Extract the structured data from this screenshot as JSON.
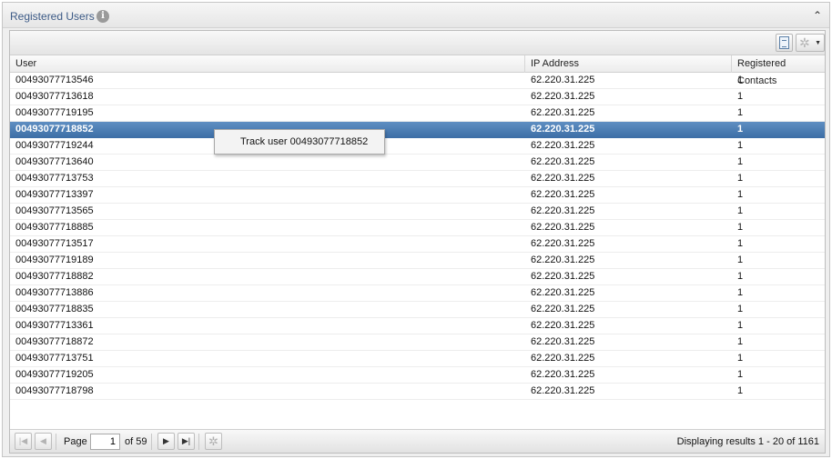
{
  "panel": {
    "title": "Registered Users",
    "info_icon": "i",
    "collapse_icon": "⌃"
  },
  "toolbar": {
    "export_icon": "export-icon",
    "settings_icon": "gear-icon"
  },
  "columns": {
    "user": "User",
    "ip": "IP Address",
    "contacts": "Registered Contacts"
  },
  "rows": [
    {
      "user": "00493077713546",
      "ip": "62.220.31.225",
      "contacts": "1"
    },
    {
      "user": "00493077713618",
      "ip": "62.220.31.225",
      "contacts": "1"
    },
    {
      "user": "00493077719195",
      "ip": "62.220.31.225",
      "contacts": "1"
    },
    {
      "user": "00493077718852",
      "ip": "62.220.31.225",
      "contacts": "1"
    },
    {
      "user": "00493077719244",
      "ip": "62.220.31.225",
      "contacts": "1"
    },
    {
      "user": "00493077713640",
      "ip": "62.220.31.225",
      "contacts": "1"
    },
    {
      "user": "00493077713753",
      "ip": "62.220.31.225",
      "contacts": "1"
    },
    {
      "user": "00493077713397",
      "ip": "62.220.31.225",
      "contacts": "1"
    },
    {
      "user": "00493077713565",
      "ip": "62.220.31.225",
      "contacts": "1"
    },
    {
      "user": "00493077718885",
      "ip": "62.220.31.225",
      "contacts": "1"
    },
    {
      "user": "00493077713517",
      "ip": "62.220.31.225",
      "contacts": "1"
    },
    {
      "user": "00493077719189",
      "ip": "62.220.31.225",
      "contacts": "1"
    },
    {
      "user": "00493077718882",
      "ip": "62.220.31.225",
      "contacts": "1"
    },
    {
      "user": "00493077713886",
      "ip": "62.220.31.225",
      "contacts": "1"
    },
    {
      "user": "00493077718835",
      "ip": "62.220.31.225",
      "contacts": "1"
    },
    {
      "user": "00493077713361",
      "ip": "62.220.31.225",
      "contacts": "1"
    },
    {
      "user": "00493077718872",
      "ip": "62.220.31.225",
      "contacts": "1"
    },
    {
      "user": "00493077713751",
      "ip": "62.220.31.225",
      "contacts": "1"
    },
    {
      "user": "00493077719205",
      "ip": "62.220.31.225",
      "contacts": "1"
    },
    {
      "user": "00493077718798",
      "ip": "62.220.31.225",
      "contacts": "1"
    }
  ],
  "selected_row": 3,
  "context_menu": {
    "item": "Track user 00493077718852"
  },
  "paging": {
    "page_label": "Page",
    "current_page": "1",
    "of_label": "of 59",
    "display_info": "Displaying results 1 - 20 of 1161",
    "first_icon": "first-page-icon",
    "prev_icon": "prev-page-icon",
    "next_icon": "next-page-icon",
    "last_icon": "last-page-icon",
    "refresh_icon": "refresh-icon"
  },
  "colors": {
    "title": "#3c5a86",
    "selected_row": "#4b7db3"
  }
}
